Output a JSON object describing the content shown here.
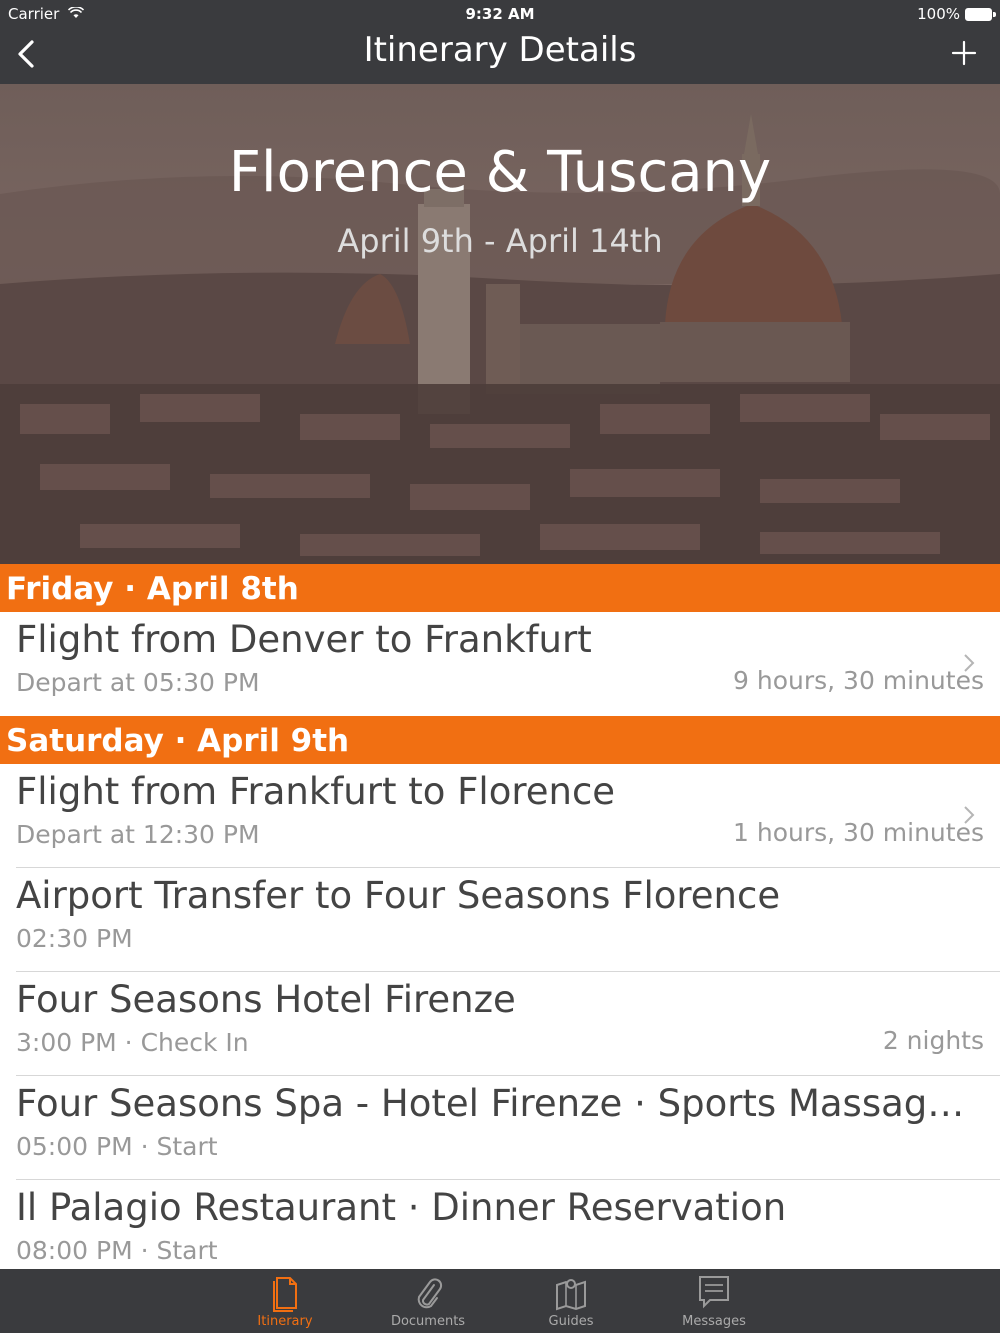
{
  "status_bar": {
    "carrier": "Carrier",
    "time": "9:32 AM",
    "battery": "100%"
  },
  "nav": {
    "title": "Itinerary Details",
    "back_icon": "chevron-left-icon",
    "add_icon": "plus-icon"
  },
  "hero": {
    "title": "Florence & Tuscany",
    "dates": "April 9th - April 14th"
  },
  "days": [
    {
      "header": "Friday · April 8th",
      "items": [
        {
          "title": "Flight from Denver to Frankfurt",
          "subtitle": "Depart at 05:30 PM",
          "right": "9 hours, 30 minutes",
          "chevron": true
        }
      ]
    },
    {
      "header": "Saturday · April 9th",
      "items": [
        {
          "title": "Flight from Frankfurt to Florence",
          "subtitle": "Depart at 12:30 PM",
          "right": "1 hours, 30 minutes",
          "chevron": true
        },
        {
          "title": "Airport Transfer to Four Seasons Florence",
          "subtitle": "02:30 PM",
          "right": "",
          "chevron": false
        },
        {
          "title": "Four Seasons Hotel Firenze",
          "subtitle": "3:00 PM · Check In",
          "right": "2 nights",
          "chevron": false
        },
        {
          "title": "Four Seasons Spa - Hotel Firenze · Sports Massage (...",
          "subtitle": "05:00 PM · Start",
          "right": "",
          "chevron": false
        },
        {
          "title": "Il Palagio Restaurant · Dinner Reservation",
          "subtitle": "08:00 PM · Start",
          "right": "",
          "chevron": false
        }
      ]
    }
  ],
  "tabs": [
    {
      "label": "Itinerary",
      "icon": "document-icon",
      "active": true
    },
    {
      "label": "Documents",
      "icon": "paperclip-icon",
      "active": false
    },
    {
      "label": "Guides",
      "icon": "map-icon",
      "active": false
    },
    {
      "label": "Messages",
      "icon": "message-icon",
      "active": false
    }
  ],
  "colors": {
    "accent": "#f16f12",
    "bar": "#3a3b3e"
  }
}
